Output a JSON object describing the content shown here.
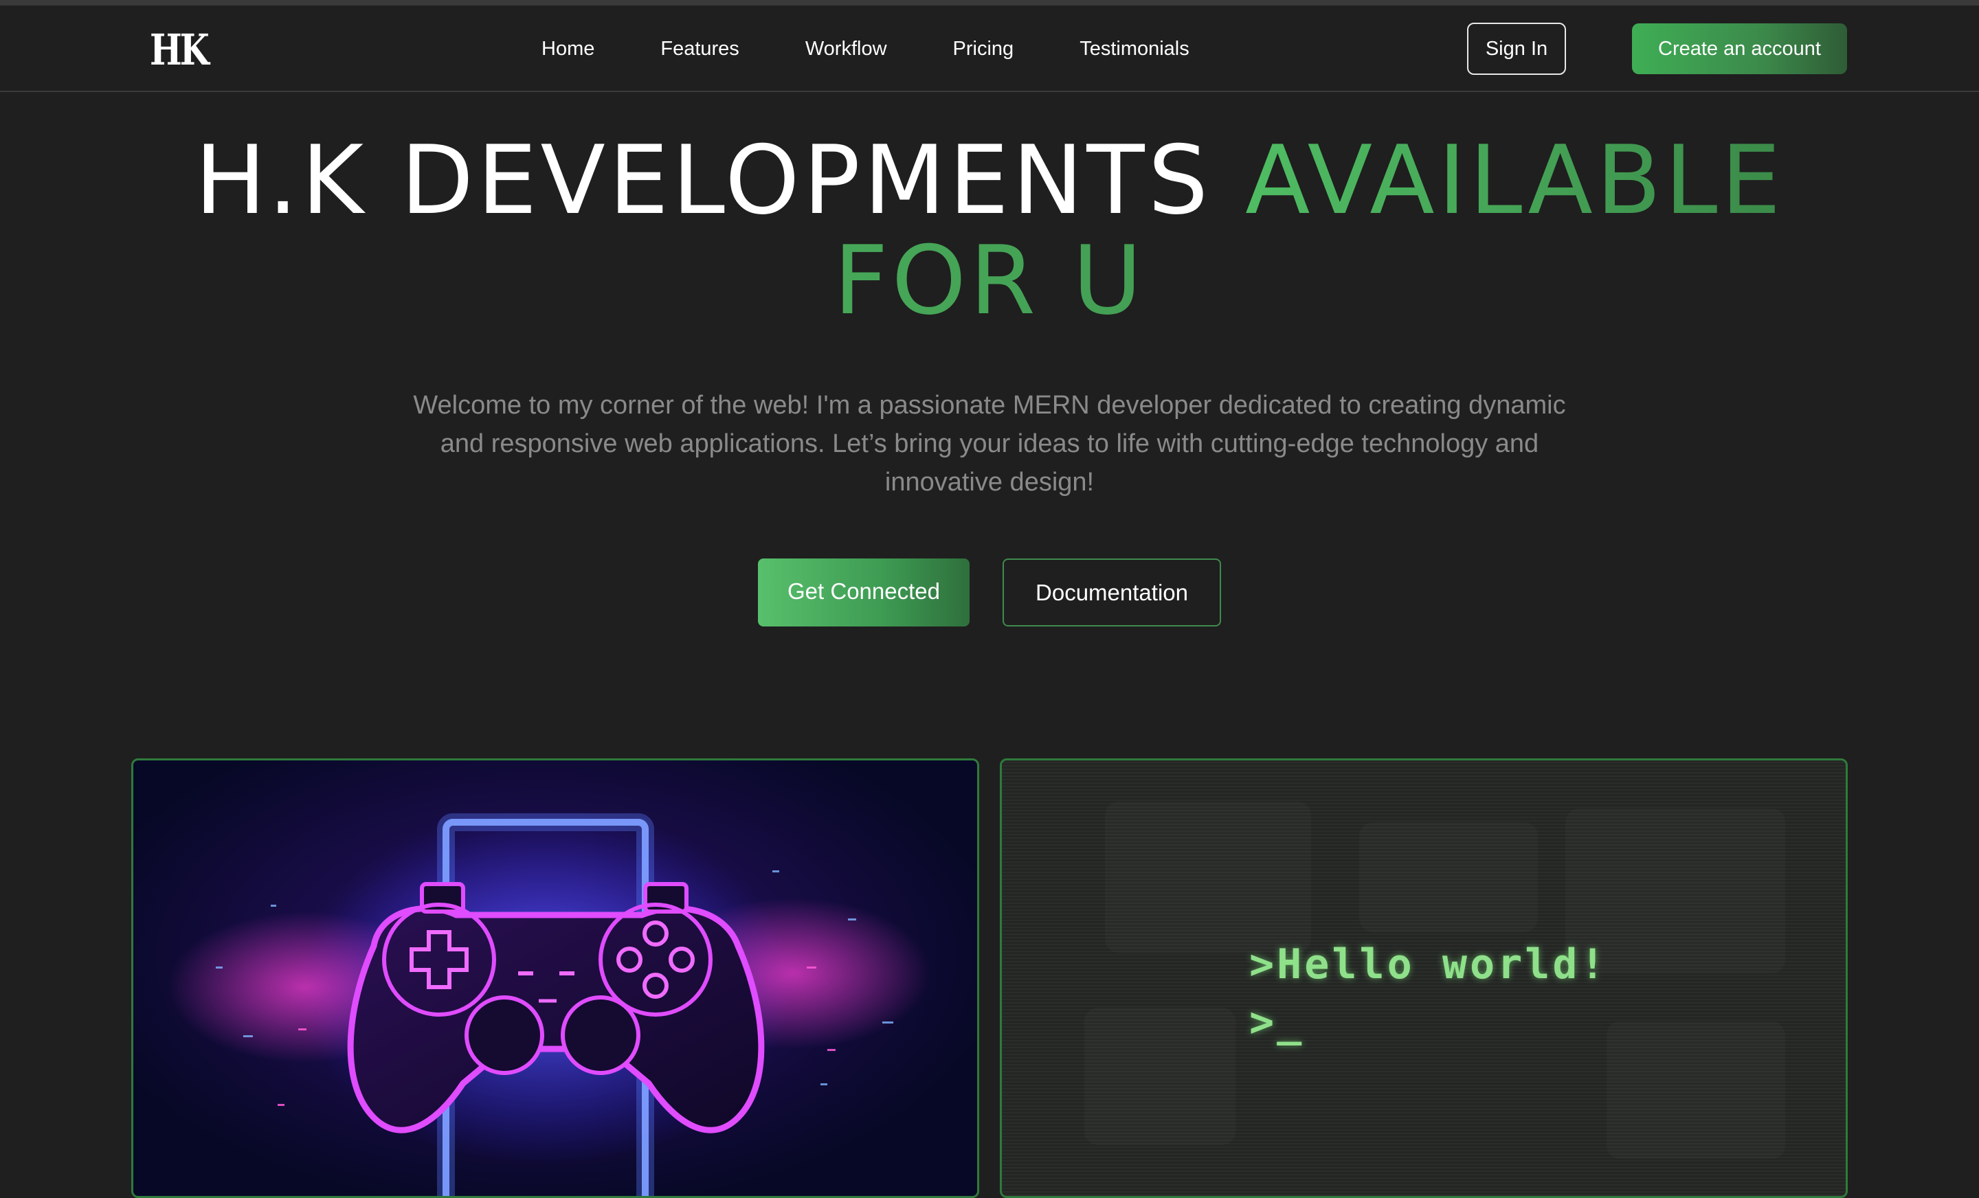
{
  "brand": {
    "logo_text": "HK"
  },
  "nav": {
    "links": [
      "Home",
      "Features",
      "Workflow",
      "Pricing",
      "Testimonials"
    ],
    "sign_in_label": "Sign In",
    "create_account_label": "Create an account"
  },
  "hero": {
    "title_white": "H.K DEVELOPMENTS",
    "title_green_1": "AVAILABLE",
    "title_green_2": "FOR U",
    "description": "Welcome to my corner of the web! I'm a passionate MERN developer dedicated to creating dynamic and responsive web applications. Let’s bring your ideas to life with cutting-edge technology and innovative design!",
    "primary_button": "Get Connected",
    "secondary_button": "Documentation"
  },
  "cards": {
    "game_icon": "gamepad-icon",
    "terminal_lines": [
      ">Hello world!",
      ">_"
    ]
  },
  "colors": {
    "background": "#1f1f1f",
    "accent_green": "#3fae55",
    "card_border": "#2f7a3c",
    "terminal_text": "#8fe08a",
    "neon_pink": "#e04cff",
    "neon_blue": "#4c7bff"
  }
}
